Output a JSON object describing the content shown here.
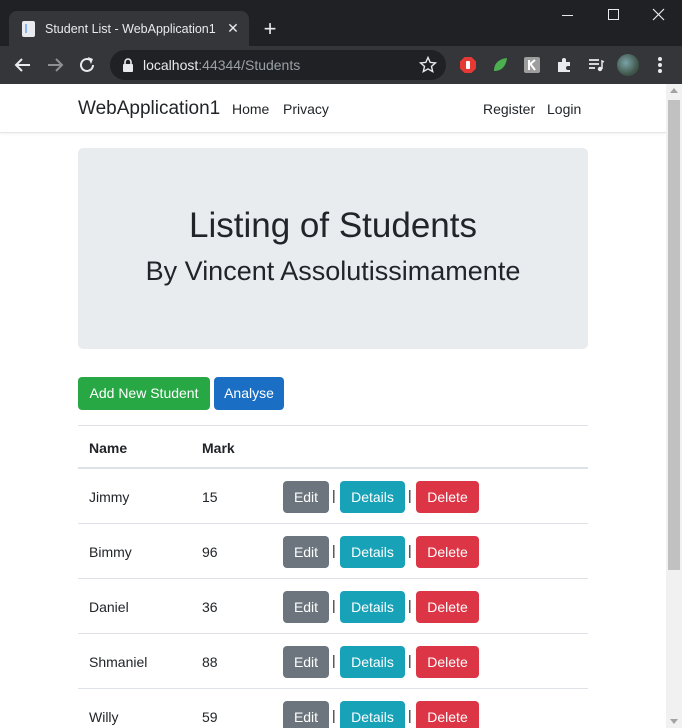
{
  "browser": {
    "tab_title": "Student List - WebApplication1",
    "url_host": "localhost",
    "url_rest": ":44344/Students"
  },
  "navbar": {
    "brand": "WebApplication1",
    "links": [
      "Home",
      "Privacy"
    ],
    "right_links": [
      "Register",
      "Login"
    ]
  },
  "jumbotron": {
    "title": "Listing of Students",
    "subtitle": "By Vincent Assolutissimamente"
  },
  "buttons": {
    "add": "Add New Student",
    "analyse": "Analyse"
  },
  "table": {
    "headers": [
      "Name",
      "Mark"
    ],
    "actions": {
      "edit": "Edit",
      "details": "Details",
      "delete": "Delete",
      "separator": "|"
    },
    "rows": [
      {
        "name": "Jimmy",
        "mark": "15"
      },
      {
        "name": "Bimmy",
        "mark": "96"
      },
      {
        "name": "Daniel",
        "mark": "36"
      },
      {
        "name": "Shmaniel",
        "mark": "88"
      },
      {
        "name": "Willy",
        "mark": "59"
      }
    ]
  },
  "colors": {
    "success": "#28a745",
    "primary": "#1a6fc4",
    "secondary": "#6c757d",
    "info": "#17a2b8",
    "danger": "#dc3545",
    "jumbotron_bg": "#e9ecef"
  }
}
